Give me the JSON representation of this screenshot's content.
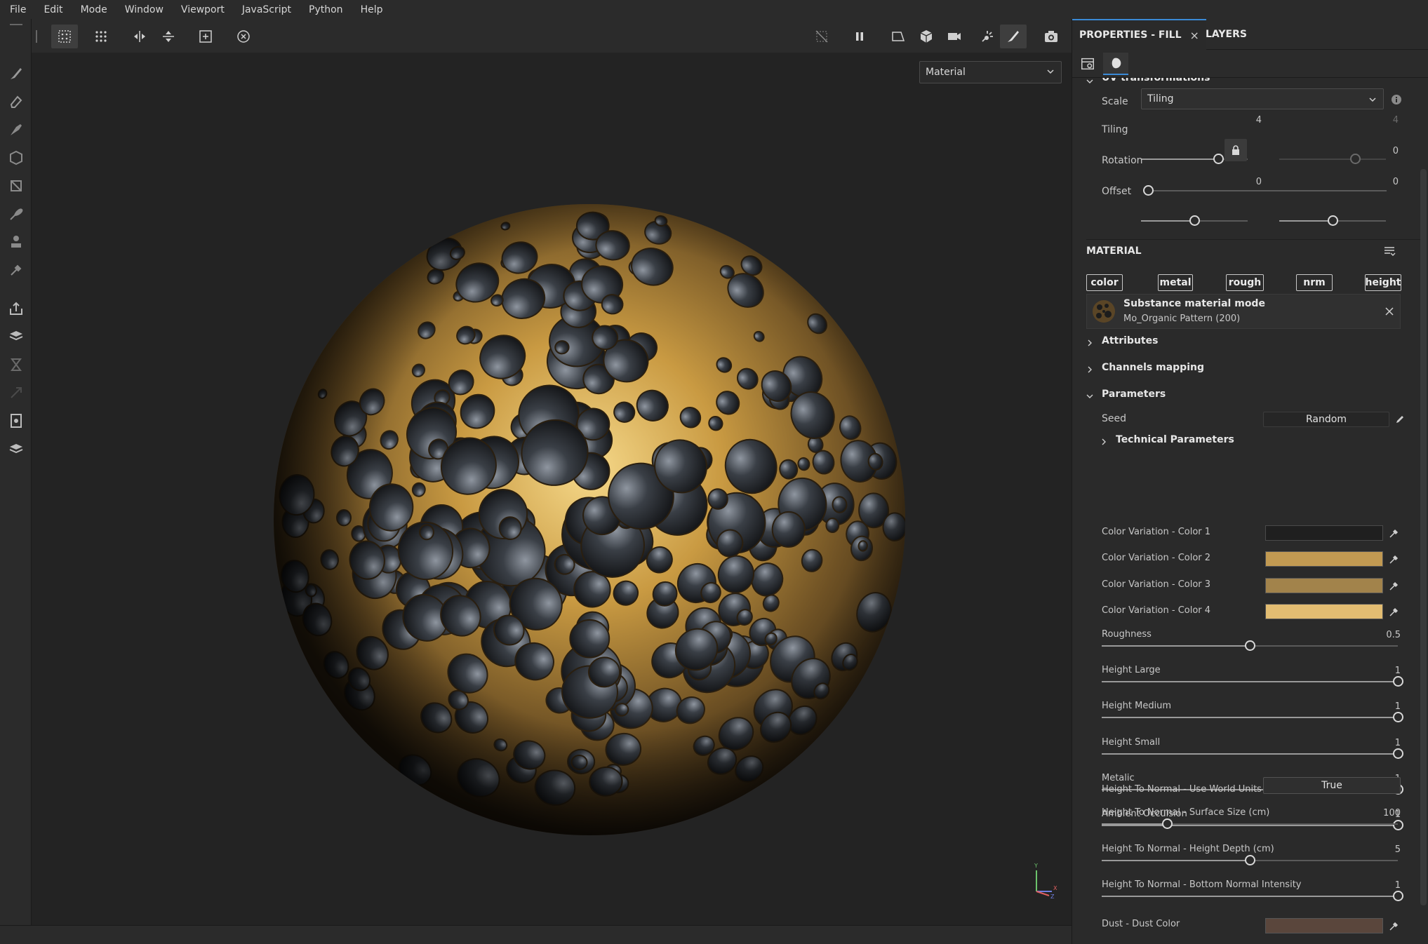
{
  "menu": [
    "File",
    "Edit",
    "Mode",
    "Window",
    "Viewport",
    "JavaScript",
    "Python",
    "Help"
  ],
  "viewport": {
    "material_dropdown": "Material",
    "axis_labels": {
      "y": "Y",
      "x": "X",
      "z": "Z"
    }
  },
  "panel": {
    "tabs": [
      {
        "label": "PROPERTIES - FILL",
        "close": "×"
      },
      {
        "label": "LAYERS"
      }
    ],
    "uv": {
      "header": "UV transformations",
      "scale_label": "Scale",
      "scale_value": "Tiling",
      "tiling_label": "Tiling",
      "tiling_value_1": "4",
      "tiling_value_2": "4",
      "rotation_label": "Rotation",
      "rotation_value": "0",
      "offset_label": "Offset",
      "offset_value_1": "0",
      "offset_value_2": "0"
    },
    "material": {
      "header": "MATERIAL",
      "channels": [
        "color",
        "metal",
        "rough",
        "nrm",
        "height"
      ],
      "mode_title": "Substance material mode",
      "mode_subtitle": "Mo_Organic Pattern (200)",
      "attributes": "Attributes",
      "channels_mapping": "Channels mapping",
      "parameters": "Parameters",
      "seed_label": "Seed",
      "seed_button": "Random",
      "technical": "Technical Parameters"
    },
    "colors": [
      {
        "label": "Color Variation - Color 1",
        "color": "#1f1f1f"
      },
      {
        "label": "Color Variation - Color 2",
        "color": "#c29a52"
      },
      {
        "label": "Color Variation - Color 3",
        "color": "#a2834b"
      },
      {
        "label": "Color Variation - Color 4",
        "color": "#e3bd72"
      }
    ],
    "sliders": [
      {
        "label": "Roughness",
        "value": "0.5",
        "fraction": 0.5
      },
      {
        "label": "Height Large",
        "value": "1",
        "fraction": 1.0
      },
      {
        "label": "Height Medium",
        "value": "1",
        "fraction": 1.0
      },
      {
        "label": "Height Small",
        "value": "1",
        "fraction": 1.0
      },
      {
        "label": "Metalic",
        "value": "1",
        "fraction": 1.0
      },
      {
        "label": "Ambient Occulsion",
        "value": "1",
        "fraction": 1.0
      }
    ],
    "world_units": {
      "label": "Height To Normal - Use World Units",
      "value": "True"
    },
    "sliders2": [
      {
        "label": "Height To Normal - Surface Size (cm)",
        "value": "100",
        "fraction": 0.22
      },
      {
        "label": "Height To Normal - Height Depth (cm)",
        "value": "5",
        "fraction": 0.5
      },
      {
        "label": "Height To Normal - Bottom Normal Intensity",
        "value": "1",
        "fraction": 1.0
      }
    ],
    "dust": {
      "label": "Dust - Dust Color",
      "color": "#5a463c"
    }
  }
}
